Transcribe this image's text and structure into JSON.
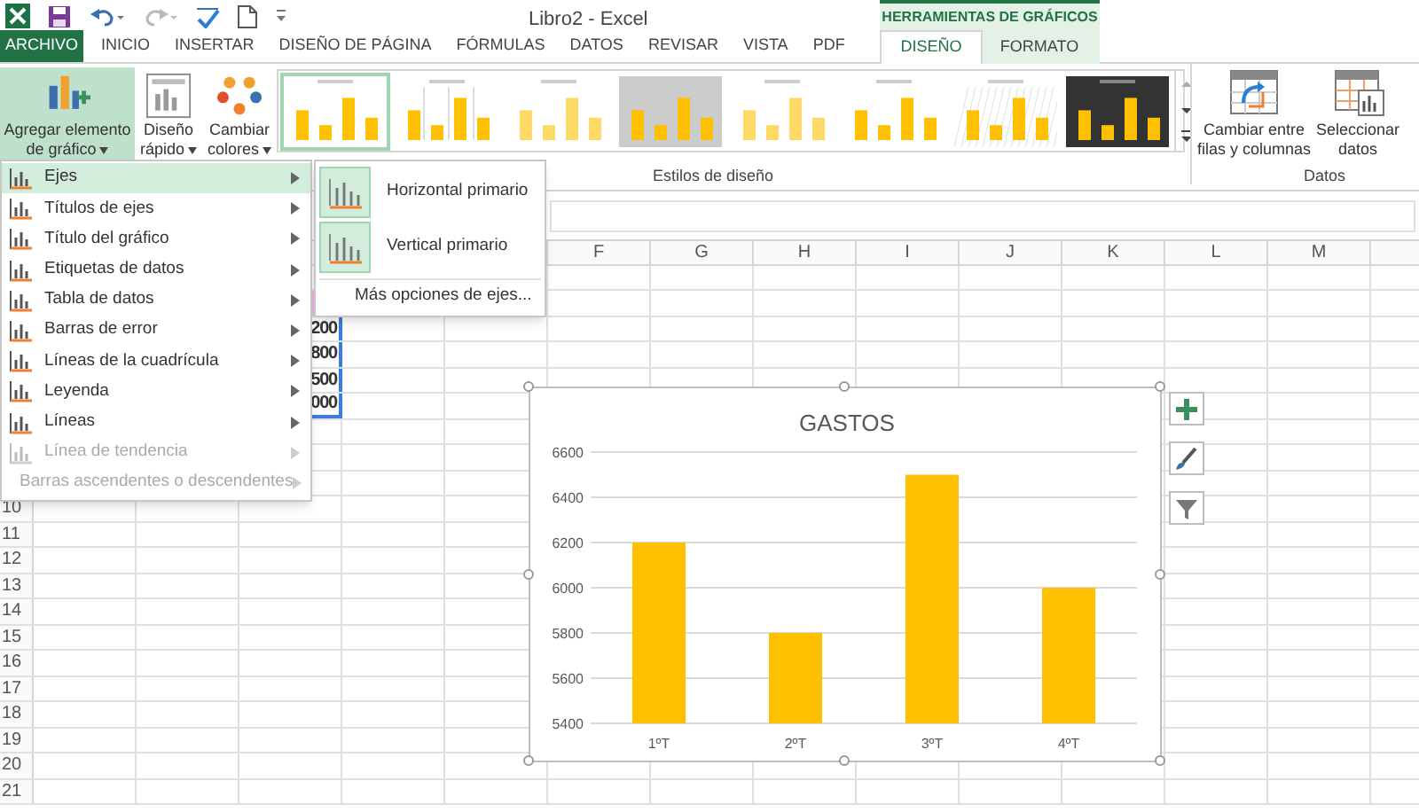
{
  "title_bar": {
    "title": "Libro2 - Excel"
  },
  "tabs": [
    {
      "label": "ARCHIVO",
      "kind": "file",
      "selected": false
    },
    {
      "label": "INICIO",
      "kind": "tab",
      "selected": false
    },
    {
      "label": "INSERTAR",
      "kind": "tab",
      "selected": false
    },
    {
      "label": "DISEÑO DE PÁGINA",
      "kind": "tab",
      "selected": false
    },
    {
      "label": "FÓRMULAS",
      "kind": "tab",
      "selected": false
    },
    {
      "label": "DATOS",
      "kind": "tab",
      "selected": false
    },
    {
      "label": "REVISAR",
      "kind": "tab",
      "selected": false
    },
    {
      "label": "VISTA",
      "kind": "tab",
      "selected": false
    },
    {
      "label": "PDF",
      "kind": "tab",
      "selected": false
    }
  ],
  "contextual_group": {
    "title": "HERRAMIENTAS DE GRÁFICOS",
    "tabs": [
      {
        "label": "DISEÑO",
        "selected": true
      },
      {
        "label": "FORMATO",
        "selected": false
      }
    ]
  },
  "ribbon": {
    "left_buttons": [
      {
        "kind": "add",
        "lines": [
          "Agregar elemento",
          "de gráfico"
        ],
        "pressed": true
      },
      {
        "kind": "layout",
        "lines": [
          "Diseño",
          "rápido"
        ],
        "pressed": false
      },
      {
        "kind": "colors",
        "lines": [
          "Cambiar",
          "colores"
        ],
        "pressed": false
      }
    ],
    "chart_styles": [
      {
        "kind": "plain",
        "selected": true
      },
      {
        "kind": "columns",
        "selected": false
      },
      {
        "kind": "faded",
        "selected": false
      },
      {
        "kind": "gray",
        "selected": false
      },
      {
        "kind": "faded",
        "selected": false
      },
      {
        "kind": "plain",
        "selected": false
      },
      {
        "kind": "hatched",
        "selected": false
      },
      {
        "kind": "dark",
        "selected": false
      }
    ],
    "styles_group_label": "Estilos de diseño",
    "data_buttons": [
      {
        "kind": "switch",
        "lines": [
          "Cambiar entre",
          "filas y columnas"
        ]
      },
      {
        "kind": "select",
        "lines": [
          "Seleccionar",
          "datos"
        ]
      }
    ],
    "data_group_label": "Datos"
  },
  "menu": {
    "items": [
      {
        "label": "Ejes",
        "selected": true,
        "disabled": false
      },
      {
        "label": "Títulos de ejes",
        "selected": false,
        "disabled": false
      },
      {
        "label": "Título del gráfico",
        "selected": false,
        "disabled": false
      },
      {
        "label": "Etiquetas de datos",
        "selected": false,
        "disabled": false
      },
      {
        "label": "Tabla de datos",
        "selected": false,
        "disabled": false
      },
      {
        "label": "Barras de error",
        "selected": false,
        "disabled": false
      },
      {
        "label": "Líneas de la cuadrícula",
        "selected": false,
        "disabled": false
      },
      {
        "label": "Leyenda",
        "selected": false,
        "disabled": false
      },
      {
        "label": "Líneas",
        "selected": false,
        "disabled": false
      },
      {
        "label": "Línea de tendencia",
        "selected": false,
        "disabled": true
      },
      {
        "label": "Barras ascendentes o descendentes",
        "selected": false,
        "disabled": true
      }
    ]
  },
  "submenu": {
    "items": [
      {
        "kind": "icon",
        "label": "Horizontal primario",
        "selected": false
      },
      {
        "kind": "icon",
        "label": "Vertical primario",
        "selected": false
      },
      {
        "kind": "link",
        "label": "Más opciones de ejes...",
        "selected": false
      }
    ]
  },
  "sheet": {
    "column_headers": [
      "F",
      "G",
      "H",
      "I",
      "J",
      "K",
      "L",
      "M"
    ],
    "row_numbers": [
      "10",
      "11",
      "12",
      "13",
      "14",
      "15",
      "16",
      "17",
      "18",
      "19",
      "20",
      "21"
    ],
    "cells": [
      "200",
      "800",
      "500",
      "000"
    ]
  },
  "chart": {
    "chart_data": {
      "type": "bar",
      "title": "GASTOS",
      "categories": [
        "1ºT",
        "2ºT",
        "3ºT",
        "4ºT"
      ],
      "values": [
        6200,
        5800,
        6500,
        6000
      ],
      "ylim": [
        5400,
        6600
      ],
      "yticks": [
        5400,
        5600,
        5800,
        6000,
        6200,
        6400,
        6600
      ],
      "grid": true
    }
  }
}
